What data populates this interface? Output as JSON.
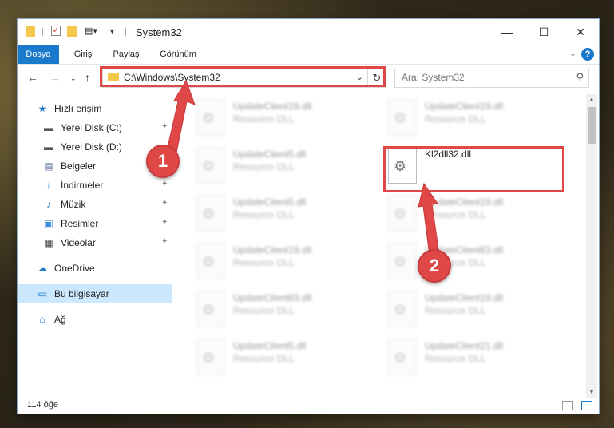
{
  "window": {
    "title": "System32",
    "controls": {
      "minimize": "—",
      "maximize": "☐",
      "close": "✕"
    }
  },
  "ribbon": {
    "tabs": [
      "Dosya",
      "Giriş",
      "Paylaş",
      "Görünüm"
    ],
    "help": "?"
  },
  "navigation": {
    "address_path": "C:\\Windows\\System32",
    "search_placeholder": "Ara: System32"
  },
  "sidebar": {
    "quick_access": "Hızlı erişim",
    "items": [
      {
        "label": "Yerel Disk (C:)",
        "icon": "drive-icon",
        "pinned": true
      },
      {
        "label": "Yerel Disk (D:)",
        "icon": "drive-icon",
        "pinned": false
      },
      {
        "label": "Belgeler",
        "icon": "documents-icon",
        "pinned": true
      },
      {
        "label": "İndirmeler",
        "icon": "download-icon",
        "pinned": true
      },
      {
        "label": "Müzik",
        "icon": "music-icon",
        "pinned": true
      },
      {
        "label": "Resimler",
        "icon": "pictures-icon",
        "pinned": true
      },
      {
        "label": "Videolar",
        "icon": "videos-icon",
        "pinned": true
      }
    ],
    "onedrive": "OneDrive",
    "this_pc": "Bu bilgisayar",
    "network": "Ağ"
  },
  "files": {
    "left_column": [
      {
        "name": "UpdateClient19.dll",
        "type": "Resource DLL"
      },
      {
        "name": "UpdateClient5.dll",
        "type": "Resource DLL"
      },
      {
        "name": "UpdateClient5.dll",
        "type": "Resource DLL"
      },
      {
        "name": "UpdateClient19.dll",
        "type": "Resource DLL"
      },
      {
        "name": "UpdateClient63.dll",
        "type": "Resource DLL"
      },
      {
        "name": "UpdateClient5.dll",
        "type": "Resource DLL"
      }
    ],
    "right_column": [
      {
        "name": "UpdateClient19.dll",
        "type": "Resource DLL"
      },
      {
        "name": "Kl2dll32.dll",
        "type": ""
      },
      {
        "name": "UpdateClient19.dll",
        "type": "Resource DLL"
      },
      {
        "name": "UpdateClient63.dll",
        "type": "Resource DLL"
      },
      {
        "name": "UpdateClient19.dll",
        "type": "Resource DLL"
      },
      {
        "name": "UpdateClient21.dll",
        "type": "Resource DLL"
      }
    ]
  },
  "status": {
    "item_count": "114 öğe"
  },
  "annotations": {
    "step1": "1",
    "step2": "2",
    "color": "#e04848"
  }
}
